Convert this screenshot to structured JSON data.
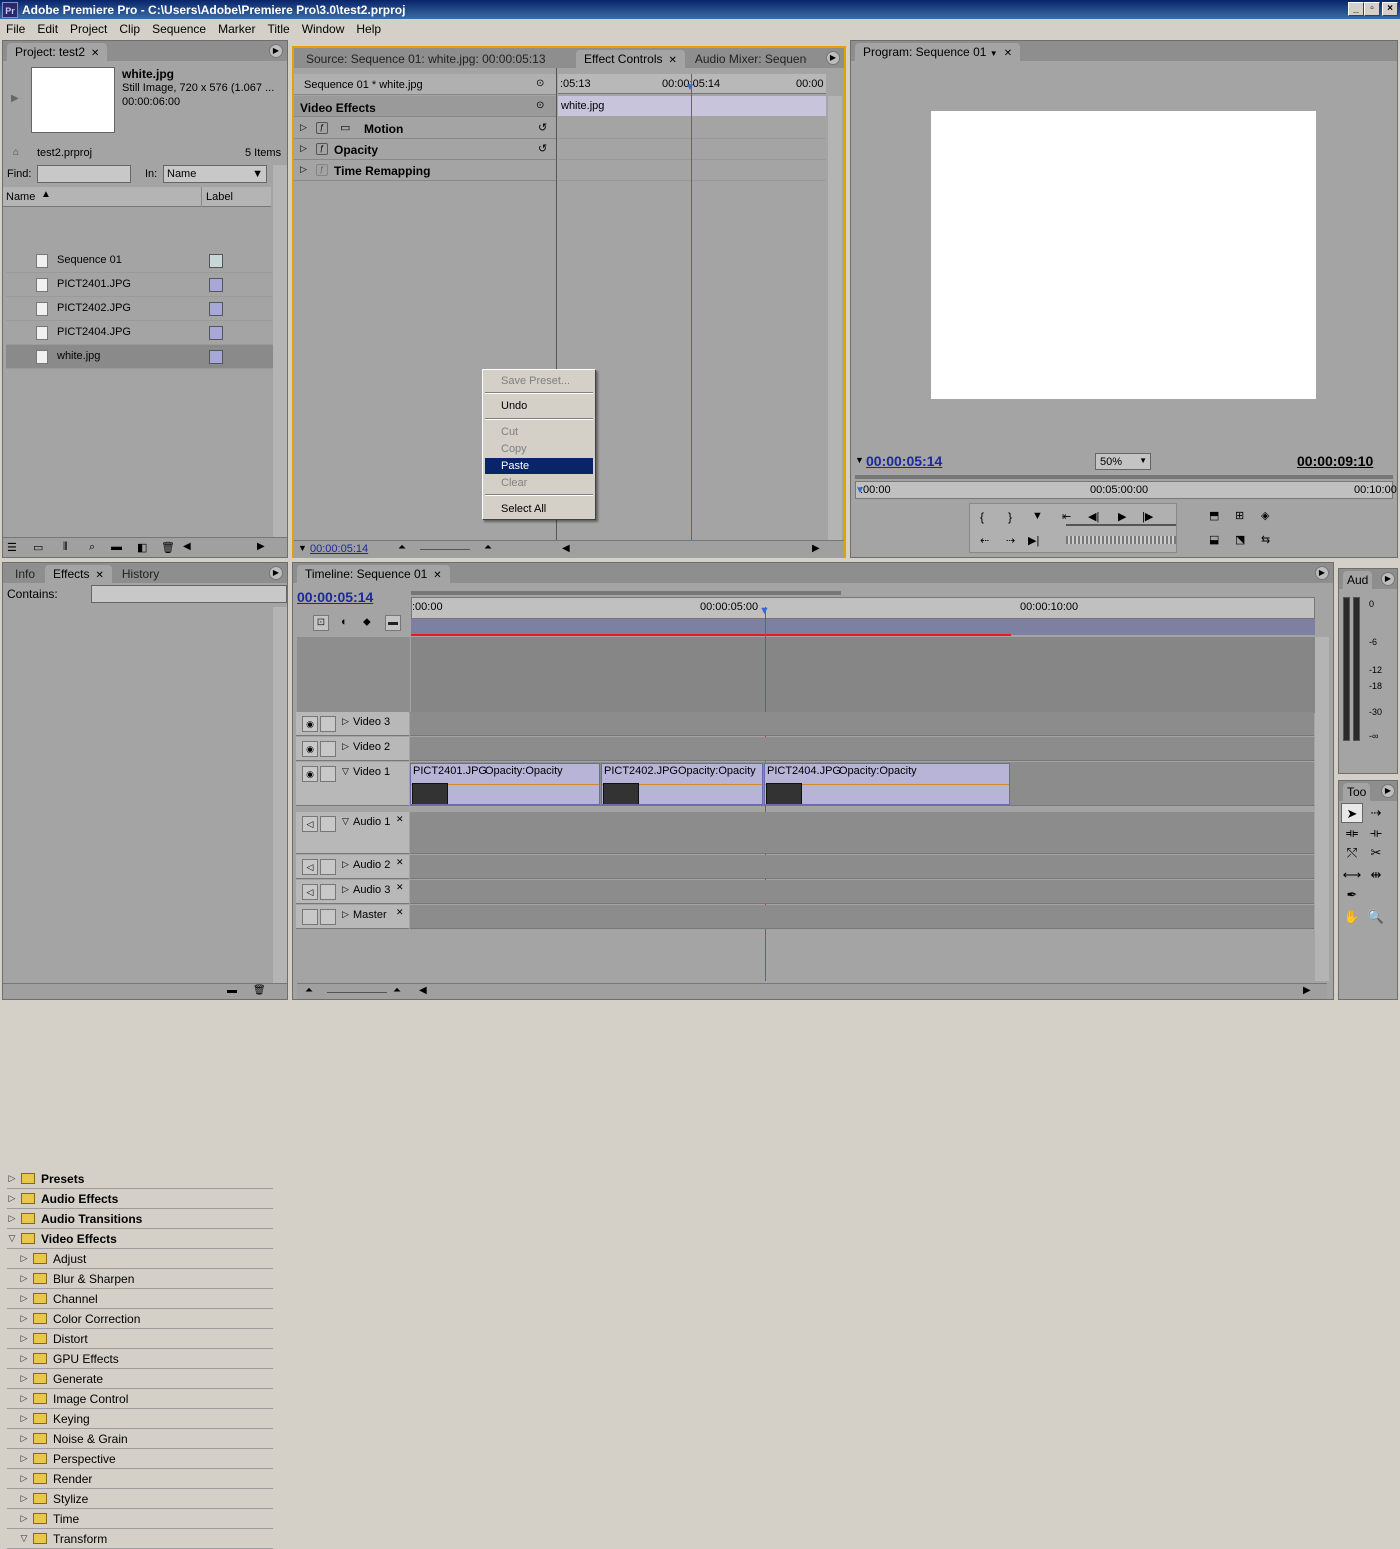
{
  "window": {
    "title": "Adobe Premiere Pro - C:\\Users\\Adobe\\Premiere Pro\\3.0\\test2.prproj",
    "app_badge": "Pr",
    "controls": [
      "_",
      "▫",
      "×"
    ]
  },
  "menu": [
    "File",
    "Edit",
    "Project",
    "Clip",
    "Sequence",
    "Marker",
    "Title",
    "Window",
    "Help"
  ],
  "project": {
    "tab": "Project: test2",
    "preview_name": "white.jpg",
    "preview_info1": "Still Image, 720 x 576 (1.067 ...",
    "preview_info2": "00:00:06:00",
    "file": "test2.prproj",
    "count": "5 Items",
    "find_label": "Find:",
    "in_label": "In:",
    "in_value": "Name",
    "col_name": "Name",
    "col_label": "Label",
    "items": [
      {
        "name": "Sequence 01",
        "color": "#c8d8d8"
      },
      {
        "name": "PICT2401.JPG",
        "color": "#a8a8d8"
      },
      {
        "name": "PICT2402.JPG",
        "color": "#a8a8d8"
      },
      {
        "name": "PICT2404.JPG",
        "color": "#a8a8d8"
      },
      {
        "name": "white.jpg",
        "color": "#a8a8d8"
      }
    ]
  },
  "source": {
    "tabs": [
      "Source: Sequence 01: white.jpg: 00:00:05:13",
      "Effect Controls",
      "Audio Mixer: Sequence"
    ],
    "clip_header": "Sequence 01 * white.jpg",
    "section": "Video Effects",
    "effects": [
      "Motion",
      "Opacity",
      "Time Remapping"
    ],
    "ruler_left": ":05:13",
    "ruler_mid": "00:00:05:14",
    "ruler_right": "00:00",
    "clip_bar": "white.jpg",
    "timecode": "00:00:05:14"
  },
  "context_menu": {
    "items": [
      "Save Preset...",
      "Undo",
      "Cut",
      "Copy",
      "Paste",
      "Clear",
      "Select All"
    ],
    "selected": "Paste"
  },
  "program": {
    "tab": "Program: Sequence 01",
    "timecode_left": "00:00:05:14",
    "zoom": "50%",
    "timecode_right": "00:00:09:10",
    "ruler": [
      ":00:00",
      "00:05:00:00",
      "00:10:00"
    ]
  },
  "effects_panel": {
    "tabs": [
      "Info",
      "Effects",
      "History"
    ],
    "contains_label": "Contains:",
    "top": [
      "Presets",
      "Audio Effects",
      "Audio Transitions",
      "Video Effects"
    ],
    "sub": [
      "Adjust",
      "Blur & Sharpen",
      "Channel",
      "Color Correction",
      "Distort",
      "GPU Effects",
      "Generate",
      "Image Control",
      "Keying",
      "Noise & Grain",
      "Perspective",
      "Render",
      "Stylize",
      "Time",
      "Transform"
    ]
  },
  "timeline": {
    "tab": "Timeline: Sequence 01",
    "timecode": "00:00:05:14",
    "ruler": [
      ":00:00",
      "00:00:05:00",
      "00:00:10:00"
    ],
    "tracks": [
      "Video 3",
      "Video 2",
      "Video 1",
      "Audio 1",
      "Audio 2",
      "Audio 3",
      "Master"
    ],
    "clips": [
      {
        "name": "PICT2401.JPG",
        "fx": "Opacity:Opacity"
      },
      {
        "name": "PICT2402.JPG",
        "fx": "Opacity:Opacity"
      },
      {
        "name": "PICT2404.JPG",
        "fx": "Opacity:Opacity"
      }
    ]
  },
  "audio_meter": {
    "tab": "Aud",
    "scale": [
      "0",
      "-6",
      "-12",
      "-18",
      "-30",
      "-∞"
    ]
  },
  "tools": {
    "tab": "Too"
  }
}
